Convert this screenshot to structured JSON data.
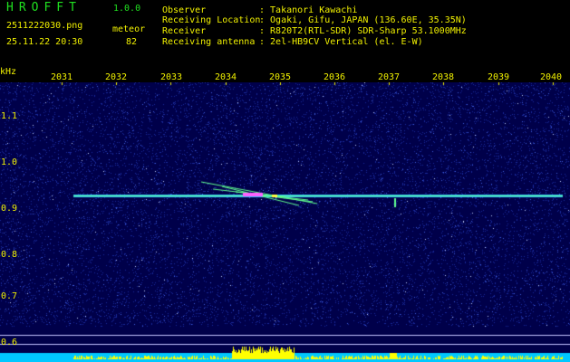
{
  "app": {
    "title": "HROFFT",
    "version": "1.0.0"
  },
  "file": {
    "name": "2511222030.png",
    "datetime": "25.11.22 20:30"
  },
  "detection": {
    "category": "meteor",
    "count": "82"
  },
  "station": {
    "observer_label": "Observer",
    "observer_value": ": Takanori Kawachi",
    "location_label": "Receiving Location",
    "location_value": ": Ogaki, Gifu, JAPAN (136.60E, 35.35N)",
    "receiver_label": "Receiver",
    "receiver_value": ": R820T2(RTL-SDR) SDR-Sharp 53.1000MHz",
    "antenna_label": "Receiving antenna",
    "antenna_value": ": 2el-HB9CV Vertical (el. E-W)"
  },
  "axes": {
    "x_ticks": [
      "2031",
      "2032",
      "2033",
      "2034",
      "2035",
      "2036",
      "2037",
      "2038",
      "2039",
      "2040"
    ],
    "y_unit": "kHz",
    "y_ticks": [
      "1.1",
      "1.0",
      "0.9",
      "0.8",
      "0.7",
      "0.6"
    ]
  },
  "colors": {
    "background": "#000000",
    "noise": "#1a2a9a",
    "carrier": "#40ff80",
    "level": "#ffff00",
    "baseline": "#00c8ff",
    "label_yellow": "#f0f000",
    "label_green": "#20e020"
  }
}
